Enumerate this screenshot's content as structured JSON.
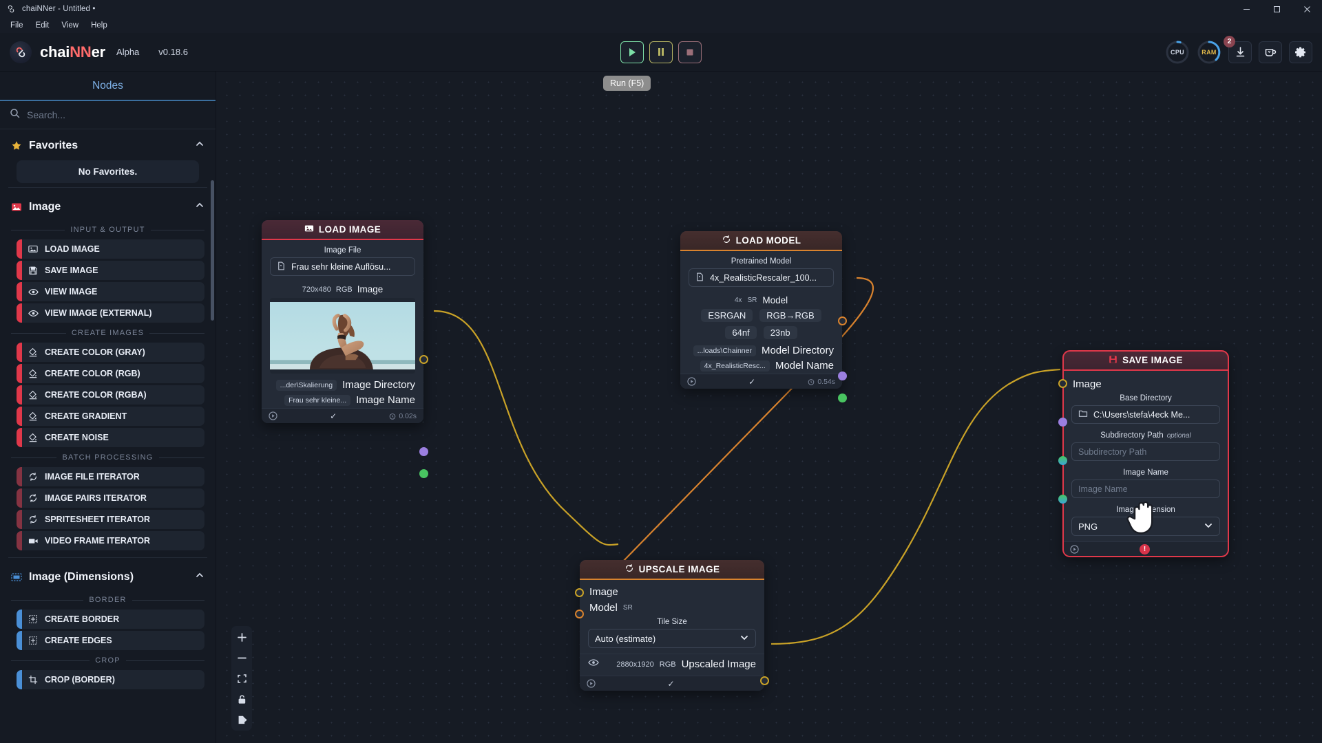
{
  "window": {
    "title": "chaiNNer - Untitled •",
    "logo_icon": "chainner-logo-icon",
    "minimize_icon": "minimize-icon",
    "maximize_icon": "maximize-icon",
    "close_icon": "close-icon"
  },
  "menu": [
    "File",
    "Edit",
    "View",
    "Help"
  ],
  "header": {
    "brand": "chaiNNer",
    "brand_prefix": "chai",
    "brand_accent": "NN",
    "brand_suffix": "er",
    "alpha": "Alpha",
    "version": "v0.18.6",
    "run_tooltip": "Run (F5)",
    "buttons": {
      "run": "run-button",
      "pause": "pause-button",
      "stop": "stop-button"
    },
    "cpu_label": "CPU",
    "ram_label": "RAM",
    "download_badge": "2",
    "accent_red": "#e0384a",
    "accent_green": "#7de0a8"
  },
  "sidebar": {
    "title": "Nodes",
    "search_placeholder": "Search...",
    "search_value": "",
    "favorites": {
      "label": "Favorites",
      "empty": "No Favorites."
    },
    "categories": [
      {
        "label": "Image",
        "color": "#e0384a",
        "groups": [
          {
            "label": "INPUT & OUTPUT",
            "items": [
              {
                "label": "LOAD IMAGE",
                "icon": "image-icon"
              },
              {
                "label": "SAVE IMAGE",
                "icon": "save-icon"
              },
              {
                "label": "VIEW IMAGE",
                "icon": "eye-icon"
              },
              {
                "label": "VIEW IMAGE (EXTERNAL)",
                "icon": "eye-icon"
              }
            ]
          },
          {
            "label": "CREATE IMAGES",
            "items": [
              {
                "label": "CREATE COLOR (GRAY)",
                "icon": "paint-bucket-icon"
              },
              {
                "label": "CREATE COLOR (RGB)",
                "icon": "paint-bucket-icon"
              },
              {
                "label": "CREATE COLOR (RGBA)",
                "icon": "paint-bucket-icon"
              },
              {
                "label": "CREATE GRADIENT",
                "icon": "paint-bucket-icon"
              },
              {
                "label": "CREATE NOISE",
                "icon": "paint-bucket-icon"
              }
            ]
          },
          {
            "label": "BATCH PROCESSING",
            "items": [
              {
                "label": "IMAGE FILE ITERATOR",
                "icon": "loop-icon"
              },
              {
                "label": "IMAGE PAIRS ITERATOR",
                "icon": "loop-icon"
              },
              {
                "label": "SPRITESHEET ITERATOR",
                "icon": "loop-icon"
              },
              {
                "label": "VIDEO FRAME ITERATOR",
                "icon": "video-icon"
              }
            ]
          }
        ]
      },
      {
        "label": "Image (Dimensions)",
        "color": "#4a8fd6",
        "groups": [
          {
            "label": "BORDER",
            "items": [
              {
                "label": "CREATE BORDER",
                "icon": "border-icon"
              },
              {
                "label": "CREATE EDGES",
                "icon": "border-icon"
              }
            ]
          },
          {
            "label": "CROP",
            "items": [
              {
                "label": "CROP (BORDER)",
                "icon": "crop-icon"
              }
            ]
          }
        ]
      }
    ]
  },
  "nodes": {
    "load_image": {
      "title": "LOAD IMAGE",
      "icon": "image-icon",
      "field_label": "Image File",
      "field_value": "Frau sehr kleine Auflösu...",
      "meta_dim": "720x480",
      "meta_rgb": "RGB",
      "meta_name": "Image",
      "out_dir_chip": "...der\\Skalierung",
      "out_dir_name": "Image Directory",
      "out_name_chip": "Frau sehr kleine...",
      "out_name_name": "Image Name",
      "time": "0.02s",
      "status": "✓"
    },
    "load_model": {
      "title": "LOAD MODEL",
      "icon": "loop-icon",
      "field_label": "Pretrained Model",
      "field_value": "4x_RealisticRescaler_100...",
      "scale": "4x",
      "kind": "SR",
      "out_model": "Model",
      "arch": "ESRGAN",
      "channels": "RGB→RGB",
      "nf": "64nf",
      "nb": "23nb",
      "out_dir_chip": "...loads\\Chainner",
      "out_dir_name": "Model Directory",
      "out_name_chip": "4x_RealisticResc...",
      "out_name_name": "Model Name",
      "time": "0.54s",
      "status": "✓"
    },
    "upscale_image": {
      "title": "UPSCALE IMAGE",
      "icon": "loop-icon",
      "in_image": "Image",
      "in_model": "Model",
      "in_model_tag": "SR",
      "tile_label": "Tile Size",
      "tile_value": "Auto (estimate)",
      "out_dim": "2880x1920",
      "out_rgb": "RGB",
      "out_name": "Upscaled Image",
      "status": "✓"
    },
    "save_image": {
      "title": "SAVE IMAGE",
      "icon": "save-icon",
      "in_image": "Image",
      "base_dir_label": "Base Directory",
      "base_dir_value": "C:\\Users\\stefa\\4eck Me...",
      "subdir_label": "Subdirectory Path",
      "subdir_optional": "optional",
      "subdir_placeholder": "Subdirectory Path",
      "name_label": "Image Name",
      "name_placeholder": "Image Name",
      "ext_label": "Image Extension",
      "ext_value": "PNG",
      "error": "!"
    }
  },
  "canvas_controls": [
    {
      "name": "zoom-in-button",
      "icon": "plus-icon"
    },
    {
      "name": "zoom-out-button",
      "icon": "minus-icon"
    },
    {
      "name": "fit-view-button",
      "icon": "fit-icon"
    },
    {
      "name": "lock-button",
      "icon": "lock-icon"
    },
    {
      "name": "export-button",
      "icon": "export-icon"
    }
  ],
  "cursor": "grab-hand-cursor"
}
